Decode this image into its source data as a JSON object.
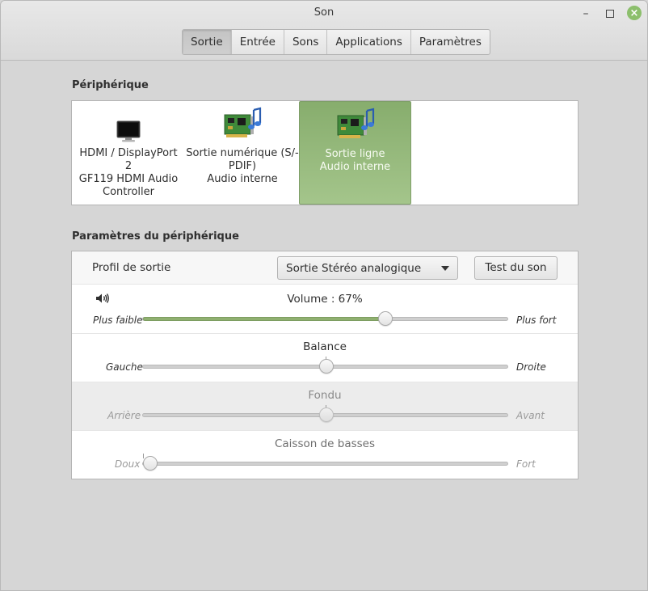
{
  "window": {
    "title": "Son"
  },
  "tabs": [
    {
      "label": "Sortie",
      "active": true
    },
    {
      "label": "Entrée",
      "active": false
    },
    {
      "label": "Sons",
      "active": false
    },
    {
      "label": "Applications",
      "active": false
    },
    {
      "label": "Paramètres",
      "active": false
    }
  ],
  "devices_section": {
    "title": "Périphérique",
    "items": [
      {
        "lines": [
          "HDMI / DisplayPort",
          "2",
          "GF119 HDMI Audio",
          "Controller"
        ],
        "icon": "monitor-icon",
        "selected": false
      },
      {
        "lines": [
          "Sortie numérique (S/-",
          "PDIF)",
          "Audio interne"
        ],
        "icon": "sound-card-icon",
        "selected": false
      },
      {
        "lines": [
          "Sortie ligne",
          "Audio interne"
        ],
        "icon": "sound-card-icon",
        "selected": true
      }
    ]
  },
  "settings_section": {
    "title": "Paramètres du périphérique",
    "profile_label": "Profil de sortie",
    "profile_value": "Sortie Stéréo analogique",
    "test_button": "Test du son",
    "volume": {
      "title": "Volume : 67%",
      "left": "Plus faible",
      "right": "Plus fort",
      "value": 0.67,
      "icon": "speaker-icon"
    },
    "balance": {
      "title": "Balance",
      "left": "Gauche",
      "right": "Droite",
      "value": 0.5
    },
    "fade": {
      "title": "Fondu",
      "left": "Arrière",
      "right": "Avant",
      "value": 0.5,
      "disabled": true
    },
    "subwoofer": {
      "title": "Caisson de basses",
      "left": "Doux",
      "right": "Fort",
      "value": 0.0,
      "disabled": true
    }
  },
  "colors": {
    "accent": "#8fb070",
    "close_button": "#8cbf6c",
    "selected_device": "#98bb7e"
  }
}
